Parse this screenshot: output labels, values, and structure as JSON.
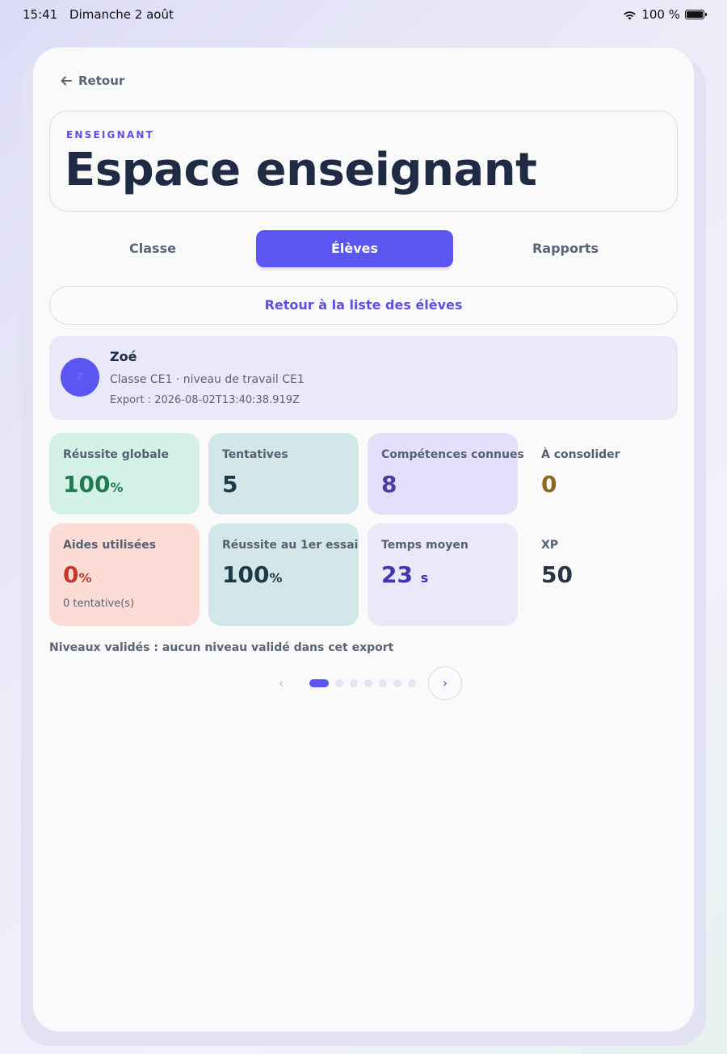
{
  "status_bar": {
    "time": "15:41",
    "date": "Dimanche 2 août",
    "battery": "100 %"
  },
  "nav": {
    "back_label": "Retour"
  },
  "header": {
    "eyebrow": "ENSEIGNANT",
    "title": "Espace enseignant"
  },
  "tabs": [
    {
      "label": "Classe",
      "active": false
    },
    {
      "label": "Élèves",
      "active": true
    },
    {
      "label": "Rapports",
      "active": false
    }
  ],
  "back_to_list_label": "Retour à la liste des élèves",
  "student": {
    "avatar_initial": "Z",
    "name": "Zoé",
    "class_line": "Classe CE1 · niveau de travail CE1",
    "export_line": "Export : 2026-08-02T13:40:38.919Z"
  },
  "stats": {
    "success": {
      "label": "Réussite globale",
      "value": "100",
      "unit": "%"
    },
    "attempts": {
      "label": "Tentatives",
      "value": "5"
    },
    "skills": {
      "label": "Compétences connues",
      "value": "8"
    },
    "consolidate": {
      "label": "À consolider",
      "value": "0"
    },
    "hints": {
      "label": "Aides utilisées",
      "value": "0",
      "unit": "%",
      "note": "0 tentative(s)"
    },
    "first_try": {
      "label": "Réussite au 1er essai",
      "value": "100",
      "unit": "%"
    },
    "avg_time": {
      "label": "Temps moyen",
      "value": "23",
      "unit": "s"
    },
    "xp": {
      "label": "XP",
      "value": "50"
    }
  },
  "levels_line": "Niveaux validés : aucun niveau validé dans cet export",
  "pager": {
    "prev": "‹",
    "next": "›",
    "page_count": 7,
    "current_page": 1
  },
  "colors": {
    "accent": "#5b55f2",
    "success_bg": "#d3f1e5",
    "success_text": "#1f7a55",
    "teal_bg": "#d3e6e9",
    "teal_text": "#1c3a48",
    "purple_bg": "#e4dffb",
    "purple_text": "#4b3c9e",
    "warn_text": "#8b6a1c",
    "danger_bg": "#fddcd6",
    "danger_text": "#c0392b",
    "lavender_bg": "#eae8f9",
    "indigo_text": "#3d36b8",
    "dark_text": "#1f2a44"
  },
  "icons": {
    "back": "arrow-left-icon",
    "wifi": "wifi-icon",
    "battery": "battery-icon"
  }
}
